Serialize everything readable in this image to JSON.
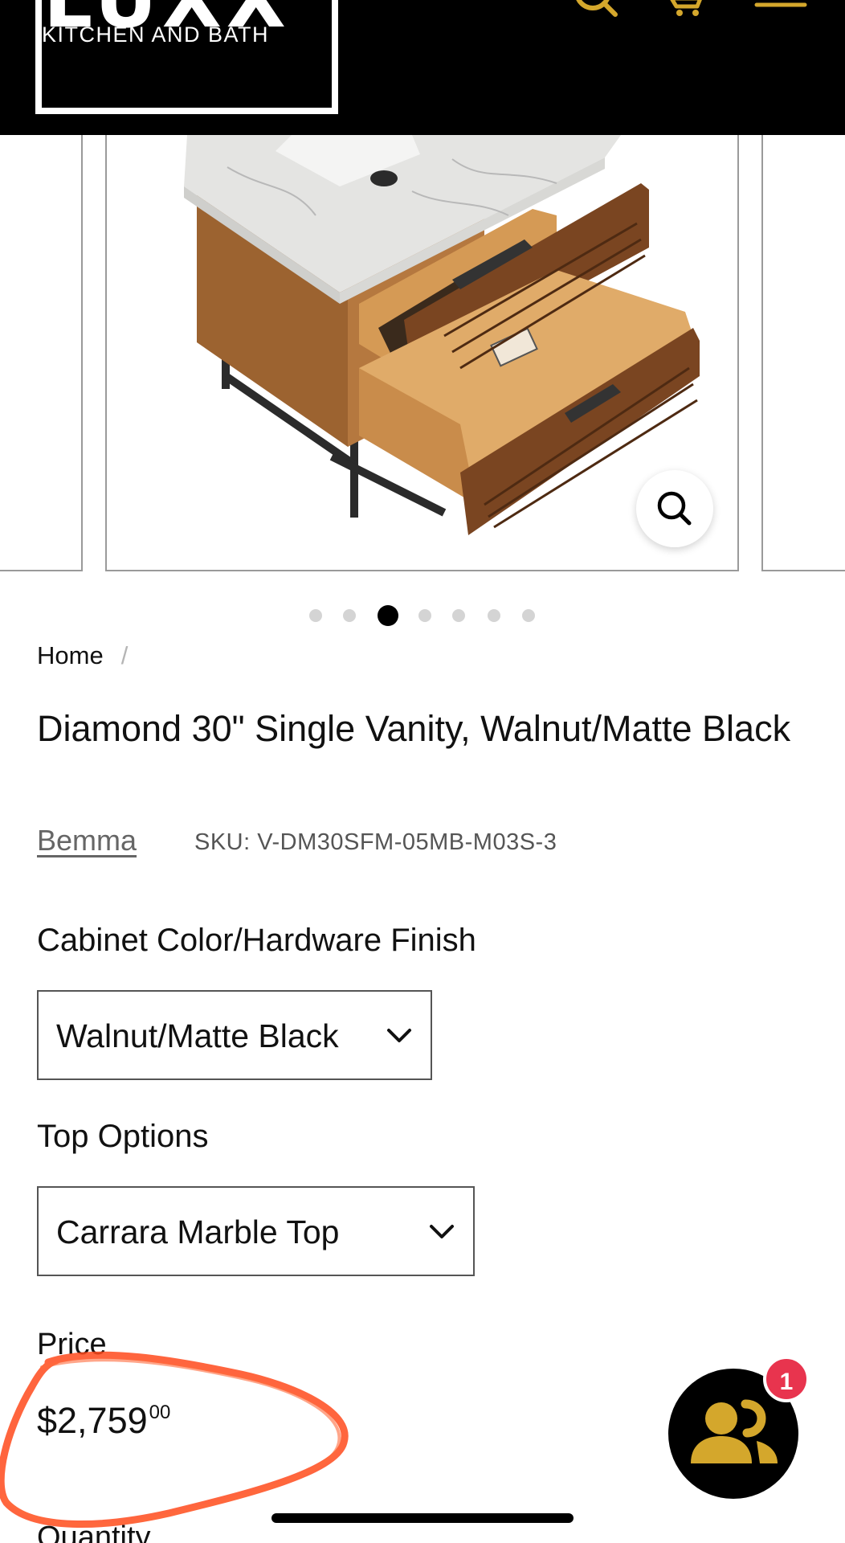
{
  "header": {
    "logo_word": "LUXX",
    "logo_subtitle": "KITCHEN AND BATH",
    "icons": [
      "search-icon",
      "cart-icon",
      "menu-icon"
    ],
    "accent_color": "#d4a72c"
  },
  "gallery": {
    "slide_count": 7,
    "active_slide": 3,
    "zoom_icon": "magnifier-icon"
  },
  "breadcrumb": {
    "home": "Home",
    "separator": "/"
  },
  "product": {
    "title": "Diamond 30\" Single Vanity, Walnut/Matte Black",
    "vendor": "Bemma",
    "sku": "SKU: V-DM30SFM-05MB-M03S-3"
  },
  "options": {
    "cabinet_label": "Cabinet Color/Hardware Finish",
    "cabinet_value": "Walnut/Matte Black",
    "top_label": "Top Options",
    "top_value": "Carrara Marble Top"
  },
  "price": {
    "label": "Price",
    "main": "$2,759",
    "cents": "00"
  },
  "quantity": {
    "label": "Quantity"
  },
  "chat": {
    "badge_count": "1",
    "icon": "users-icon",
    "badge_color": "#e8344e"
  },
  "annotation": {
    "color": "#ff4a1c",
    "shape": "hand-drawn circle around price"
  }
}
